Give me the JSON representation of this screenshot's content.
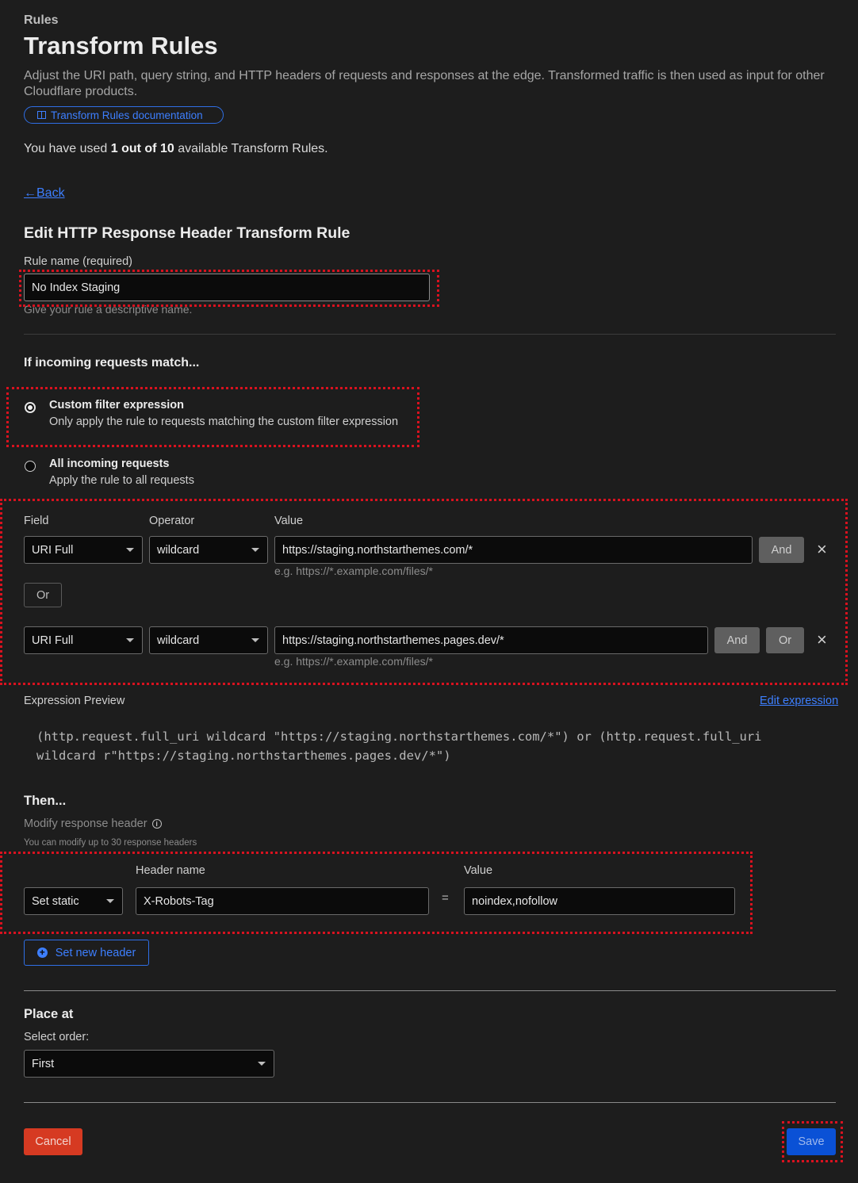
{
  "header": {
    "breadcrumb": "Rules",
    "title": "Transform Rules",
    "description": "Adjust the URI path, query string, and HTTP headers of requests and responses at the edge. Transformed traffic is then used as input for other Cloudflare products.",
    "doc_link": "Transform Rules documentation",
    "usage_prefix": "You have used ",
    "usage_count": "1 out of 10",
    "usage_suffix": " available Transform Rules."
  },
  "nav": {
    "back": "Back",
    "back_arrow": "←"
  },
  "form": {
    "title": "Edit HTTP Response Header Transform Rule",
    "rule_name_label": "Rule name (required)",
    "rule_name_value": "No Index Staging",
    "rule_name_help": "Give your rule a descriptive name."
  },
  "match": {
    "title": "If incoming requests match...",
    "options": [
      {
        "label": "Custom filter expression",
        "desc": "Only apply the rule to requests matching the custom filter expression",
        "checked": true
      },
      {
        "label": "All incoming requests",
        "desc": "Apply the rule to all requests",
        "checked": false
      }
    ]
  },
  "expression_builder": {
    "field_label": "Field",
    "operator_label": "Operator",
    "value_label": "Value",
    "rows": [
      {
        "field": "URI Full",
        "operator": "wildcard",
        "value": "https://staging.northstarthemes.com/*",
        "hint": "e.g. https://*.example.com/files/*",
        "and_label": "And"
      },
      {
        "field": "URI Full",
        "operator": "wildcard",
        "value": "https://staging.northstarthemes.pages.dev/*",
        "hint": "e.g. https://*.example.com/files/*",
        "and_label": "And",
        "or_label": "Or"
      }
    ],
    "or_separator": "Or",
    "remove_symbol": "×"
  },
  "preview": {
    "label": "Expression Preview",
    "edit_link": "Edit expression",
    "line1": "(http.request.full_uri wildcard \"https://staging.northstarthemes.com/*\") or (http.request.full_uri",
    "line2": "wildcard r\"https://staging.northstarthemes.pages.dev/*\")"
  },
  "then": {
    "title": "Then...",
    "modify_label": "Modify response header",
    "info_symbol": "i",
    "limit_note": "You can modify up to 30 response headers",
    "header_name_label": "Header name",
    "value_label": "Value",
    "action": "Set static",
    "header_name": "X-Robots-Tag",
    "equals": "=",
    "header_value": "noindex,nofollow",
    "new_header_button": "Set new header",
    "plus_symbol": "+"
  },
  "place": {
    "title": "Place at",
    "order_label": "Select order:",
    "order_value": "First"
  },
  "footer": {
    "cancel": "Cancel",
    "save": "Save"
  },
  "colors": {
    "accent": "#3d7fff",
    "danger": "#d63a22",
    "primary": "#0a51d6",
    "highlight": "#d9121f"
  }
}
